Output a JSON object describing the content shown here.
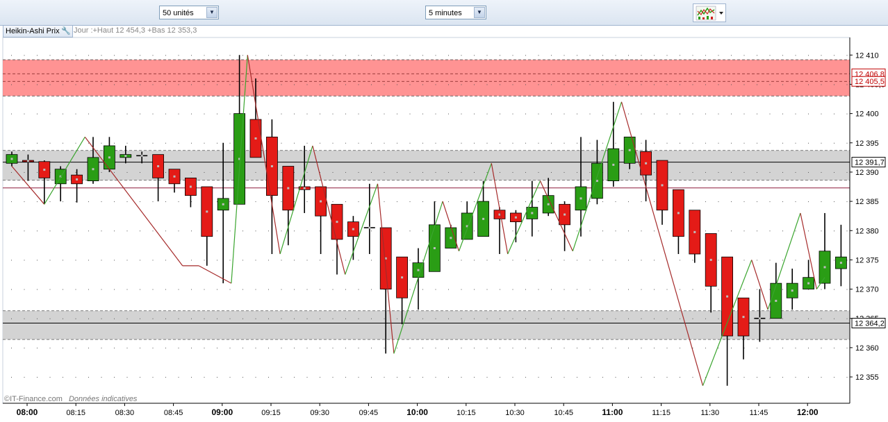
{
  "toolbar": {
    "units_select": {
      "value": "50 unités"
    },
    "interval_select": {
      "value": "5 minutes"
    },
    "chart_type_icon": "line-chart-icon"
  },
  "header": {
    "indicator_label": "Heikin-Ashi Prix",
    "indicator_icon": "wrench-icon",
    "session_info": "Jour :+Haut 12 454,3 +Bas 12 353,3"
  },
  "footer": {
    "copyright": "©IT-Finance.com",
    "disclaimer": "Données indicatives"
  },
  "colors": {
    "up": "#2a9d15",
    "down": "#e41b17",
    "zigzag_up": "#3aa52e",
    "zigzag_down": "#a52a2a",
    "resistance_zone": "#ff8080",
    "support_zone": "#d3d3d3"
  },
  "chart_data": {
    "type": "candlestick",
    "y_axis_ticks": [
      12355,
      12360,
      12365,
      12370,
      12375,
      12380,
      12385,
      12390,
      12395,
      12400,
      12405,
      12410
    ],
    "y_axis_labels": [
      "12 355",
      "12 360",
      "12 365",
      "12 370",
      "12 375",
      "12 380",
      "12 385",
      "12 390",
      "12 395",
      "12 400",
      "12 405,5",
      "12 410"
    ],
    "ylim": [
      12350.5,
      12413
    ],
    "x_ticks": [
      {
        "label": "08:00",
        "index": 0,
        "bold": true
      },
      {
        "label": "08:15",
        "index": 3
      },
      {
        "label": "08:30",
        "index": 6
      },
      {
        "label": "08:45",
        "index": 9
      },
      {
        "label": "09:00",
        "index": 12,
        "bold": true
      },
      {
        "label": "09:15",
        "index": 15
      },
      {
        "label": "09:30",
        "index": 18
      },
      {
        "label": "09:45",
        "index": 21
      },
      {
        "label": "10:00",
        "index": 24,
        "bold": true
      },
      {
        "label": "10:15",
        "index": 27
      },
      {
        "label": "10:30",
        "index": 30
      },
      {
        "label": "10:45",
        "index": 33
      },
      {
        "label": "11:00",
        "index": 36,
        "bold": true
      },
      {
        "label": "11:15",
        "index": 39
      },
      {
        "label": "11:30",
        "index": 42
      },
      {
        "label": "11:45",
        "index": 45
      },
      {
        "label": "12:00",
        "index": 48,
        "bold": true
      }
    ],
    "price_markers": [
      {
        "label": "12 406,8",
        "value": 12406.8,
        "color": "#c00000"
      },
      {
        "label": "12 405,5",
        "value": 12405.5,
        "color": "#c00000"
      },
      {
        "label": "12 391,7",
        "value": 12391.7,
        "color": "#000000"
      },
      {
        "label": "12 364,2",
        "value": 12364.2,
        "color": "#000000"
      }
    ],
    "zones": [
      {
        "from": 12403.0,
        "to": 12409.2,
        "kind": "resistance"
      },
      {
        "from": 12388.6,
        "to": 12393.7,
        "kind": "support"
      },
      {
        "from": 12361.4,
        "to": 12366.3,
        "kind": "support"
      }
    ],
    "reference_lines": [
      {
        "value": 12391.7,
        "color": "#000000"
      },
      {
        "value": 12387.3,
        "color": "#8b1a3a"
      },
      {
        "value": 12364.2,
        "color": "#000000"
      }
    ],
    "candles": [
      {
        "o": 12391.5,
        "c": 12393.0,
        "h": 12393.5,
        "l": 12391.0
      },
      {
        "o": 12392.0,
        "c": 12391.8,
        "h": 12393.0,
        "l": 12388.5
      },
      {
        "o": 12391.8,
        "c": 12389.0,
        "h": 12392.0,
        "l": 12384.5
      },
      {
        "o": 12388.0,
        "c": 12390.5,
        "h": 12391.0,
        "l": 12385.0
      },
      {
        "o": 12389.5,
        "c": 12388.0,
        "h": 12390.5,
        "l": 12384.8
      },
      {
        "o": 12388.5,
        "c": 12392.5,
        "h": 12396.0,
        "l": 12388.0
      },
      {
        "o": 12390.5,
        "c": 12394.5,
        "h": 12396.0,
        "l": 12390.0
      },
      {
        "o": 12392.5,
        "c": 12393.0,
        "h": 12394.5,
        "l": 12391.5
      },
      {
        "o": 12392.8,
        "c": 12392.8,
        "h": 12393.5,
        "l": 12391.5
      },
      {
        "o": 12393.0,
        "c": 12389.0,
        "h": 12393.0,
        "l": 12385.0
      },
      {
        "o": 12390.5,
        "c": 12388.0,
        "h": 12390.5,
        "l": 12386.5
      },
      {
        "o": 12389.0,
        "c": 12386.0,
        "h": 12389.0,
        "l": 12384.0
      },
      {
        "o": 12387.5,
        "c": 12379.0,
        "h": 12387.5,
        "l": 12374.0
      },
      {
        "o": 12383.5,
        "c": 12385.5,
        "h": 12395.0,
        "l": 12371.0
      },
      {
        "o": 12384.5,
        "c": 12400.0,
        "h": 12410.0,
        "l": 12384.5
      },
      {
        "o": 12399.0,
        "c": 12392.5,
        "h": 12406.0,
        "l": 12392.5
      },
      {
        "o": 12396.0,
        "c": 12386.0,
        "h": 12399.0,
        "l": 12376.0
      },
      {
        "o": 12391.0,
        "c": 12383.5,
        "h": 12391.0,
        "l": 12377.5
      },
      {
        "o": 12387.5,
        "c": 12387.0,
        "h": 12394.5,
        "l": 12383.0
      },
      {
        "o": 12387.5,
        "c": 12382.5,
        "h": 12387.5,
        "l": 12376.0
      },
      {
        "o": 12384.5,
        "c": 12378.5,
        "h": 12384.5,
        "l": 12372.5
      },
      {
        "o": 12381.5,
        "c": 12379.0,
        "h": 12382.5,
        "l": 12375.0
      },
      {
        "o": 12380.5,
        "c": 12380.5,
        "h": 12388.0,
        "l": 12376.0
      },
      {
        "o": 12380.5,
        "c": 12370.0,
        "h": 12380.5,
        "l": 12359.0
      },
      {
        "o": 12375.5,
        "c": 12368.5,
        "h": 12375.5,
        "l": 12364.0
      },
      {
        "o": 12372.0,
        "c": 12374.5,
        "h": 12377.0,
        "l": 12366.5
      },
      {
        "o": 12373.0,
        "c": 12381.0,
        "h": 12385.0,
        "l": 12373.0
      },
      {
        "o": 12377.0,
        "c": 12380.5,
        "h": 12381.0,
        "l": 12377.0
      },
      {
        "o": 12378.5,
        "c": 12383.0,
        "h": 12385.0,
        "l": 12378.5
      },
      {
        "o": 12379.0,
        "c": 12385.0,
        "h": 12388.5,
        "l": 12379.0
      },
      {
        "o": 12383.5,
        "c": 12382.0,
        "h": 12384.0,
        "l": 12376.0
      },
      {
        "o": 12383.0,
        "c": 12381.5,
        "h": 12383.5,
        "l": 12378.0
      },
      {
        "o": 12382.0,
        "c": 12384.0,
        "h": 12388.5,
        "l": 12379.0
      },
      {
        "o": 12383.0,
        "c": 12386.0,
        "h": 12389.0,
        "l": 12382.5
      },
      {
        "o": 12384.5,
        "c": 12381.0,
        "h": 12385.0,
        "l": 12376.5
      },
      {
        "o": 12383.5,
        "c": 12387.5,
        "h": 12396.0,
        "l": 12379.0
      },
      {
        "o": 12385.5,
        "c": 12391.5,
        "h": 12395.5,
        "l": 12384.5
      },
      {
        "o": 12388.5,
        "c": 12394.0,
        "h": 12402.0,
        "l": 12387.5
      },
      {
        "o": 12391.5,
        "c": 12396.0,
        "h": 12396.0,
        "l": 12390.5
      },
      {
        "o": 12393.5,
        "c": 12389.5,
        "h": 12395.5,
        "l": 12385.0
      },
      {
        "o": 12392.0,
        "c": 12383.5,
        "h": 12392.0,
        "l": 12381.0
      },
      {
        "o": 12387.0,
        "c": 12379.0,
        "h": 12387.0,
        "l": 12376.0
      },
      {
        "o": 12383.5,
        "c": 12376.0,
        "h": 12383.5,
        "l": 12374.5
      },
      {
        "o": 12379.5,
        "c": 12370.5,
        "h": 12379.5,
        "l": 12366.0
      },
      {
        "o": 12375.5,
        "c": 12362.0,
        "h": 12375.5,
        "l": 12353.5
      },
      {
        "o": 12368.5,
        "c": 12362.0,
        "h": 12368.5,
        "l": 12358.0
      },
      {
        "o": 12365.0,
        "c": 12365.0,
        "h": 12370.0,
        "l": 12361.0
      },
      {
        "o": 12365.0,
        "c": 12371.0,
        "h": 12374.5,
        "l": 12365.0
      },
      {
        "o": 12368.5,
        "c": 12371.0,
        "h": 12373.5,
        "l": 12366.5
      },
      {
        "o": 12370.0,
        "c": 12372.0,
        "h": 12375.0,
        "l": 12370.0
      },
      {
        "o": 12371.0,
        "c": 12376.5,
        "h": 12383.0,
        "l": 12370.0
      },
      {
        "o": 12373.5,
        "c": 12375.5,
        "h": 12381.0,
        "l": 12370.5
      }
    ],
    "zigzag": [
      {
        "i": 0,
        "v": 12391.0
      },
      {
        "i": 2,
        "v": 12384.5
      },
      {
        "i": 4.5,
        "v": 12396.0
      },
      {
        "i": 10.5,
        "v": 12374.0
      },
      {
        "i": 11.5,
        "v": 12374.0
      },
      {
        "i": 13.5,
        "v": 12371.0
      },
      {
        "i": 14.5,
        "v": 12410.0
      },
      {
        "i": 16.5,
        "v": 12376.0
      },
      {
        "i": 18.5,
        "v": 12394.5
      },
      {
        "i": 20.5,
        "v": 12372.5
      },
      {
        "i": 22.5,
        "v": 12388.0
      },
      {
        "i": 23.5,
        "v": 12359.0
      },
      {
        "i": 26.5,
        "v": 12385.0
      },
      {
        "i": 27.5,
        "v": 12376.5
      },
      {
        "i": 29.5,
        "v": 12391.5
      },
      {
        "i": 30.5,
        "v": 12376.0
      },
      {
        "i": 32.5,
        "v": 12388.5
      },
      {
        "i": 34.5,
        "v": 12376.5
      },
      {
        "i": 37.5,
        "v": 12402.0
      },
      {
        "i": 42.5,
        "v": 12353.5
      },
      {
        "i": 45.5,
        "v": 12375.0
      },
      {
        "i": 46.5,
        "v": 12366.5
      },
      {
        "i": 48.5,
        "v": 12383.0
      },
      {
        "i": 49.5,
        "v": 12370.0
      },
      {
        "i": 50.0,
        "v": 12372.0
      }
    ]
  }
}
